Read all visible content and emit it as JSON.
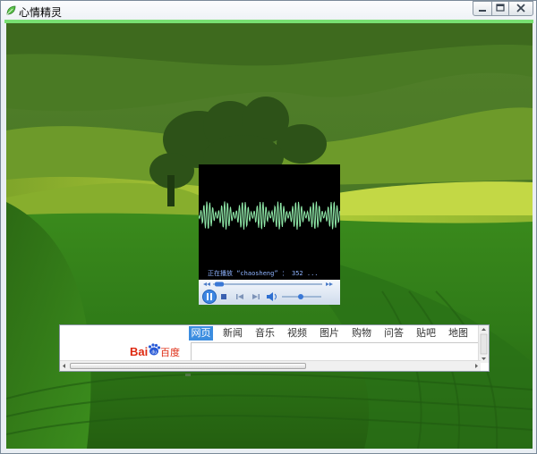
{
  "window": {
    "title": "心情精灵"
  },
  "player": {
    "now_playing": "正在播放 “chaosheng” ： 352 ..."
  },
  "browser": {
    "tabs": [
      {
        "label": "网页",
        "active": true
      },
      {
        "label": "新闻"
      },
      {
        "label": "音乐"
      },
      {
        "label": "视频"
      },
      {
        "label": "图片"
      },
      {
        "label": "购物"
      },
      {
        "label": "问答"
      },
      {
        "label": "贴吧"
      },
      {
        "label": "地图"
      }
    ],
    "logo_text": "Bai百度",
    "search_value": ""
  },
  "colors": {
    "accent_bar": "#78e072",
    "tab_active": "#3b8de0",
    "waveform": "#8fe8a8",
    "baidu_red": "#de2910",
    "baidu_blue": "#2a5bd7"
  }
}
